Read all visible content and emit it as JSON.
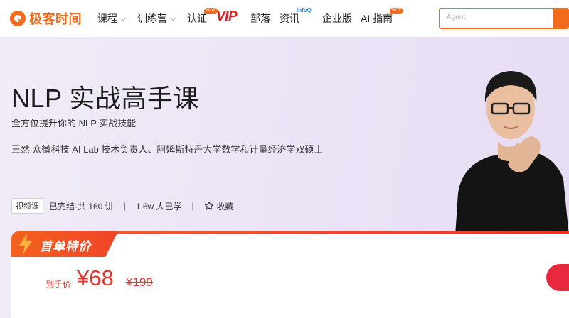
{
  "header": {
    "logo_text": "极客时间",
    "nav": [
      {
        "label": "课程",
        "dropdown": true
      },
      {
        "label": "训练营",
        "dropdown": true
      },
      {
        "label": "认证",
        "badge": "HOT"
      },
      {
        "label": "VIP"
      },
      {
        "label": "部落"
      },
      {
        "label": "资讯",
        "badge": "InfoQ"
      },
      {
        "label": "企业版"
      },
      {
        "label": "AI 指南",
        "badge": "HOT"
      }
    ],
    "search_placeholder": "Agent"
  },
  "course": {
    "title": "NLP 实战高手课",
    "subtitle": "全方位提升你的 NLP 实战技能",
    "author": "王然  众微科技 AI Lab 技术负责人、阿姆斯特丹大学数学和计量经济学双硕士",
    "type_tag": "视频课",
    "progress": "已完结·共 160 讲",
    "learners": "1.6w 人已学",
    "favorite_label": "收藏"
  },
  "price": {
    "banner": "首单特价",
    "label": "到手价",
    "current": "¥68",
    "original": "¥199"
  },
  "colors": {
    "brand": "#f26b1d",
    "price_red": "#e8352c",
    "buy_button": "#e8283c"
  }
}
